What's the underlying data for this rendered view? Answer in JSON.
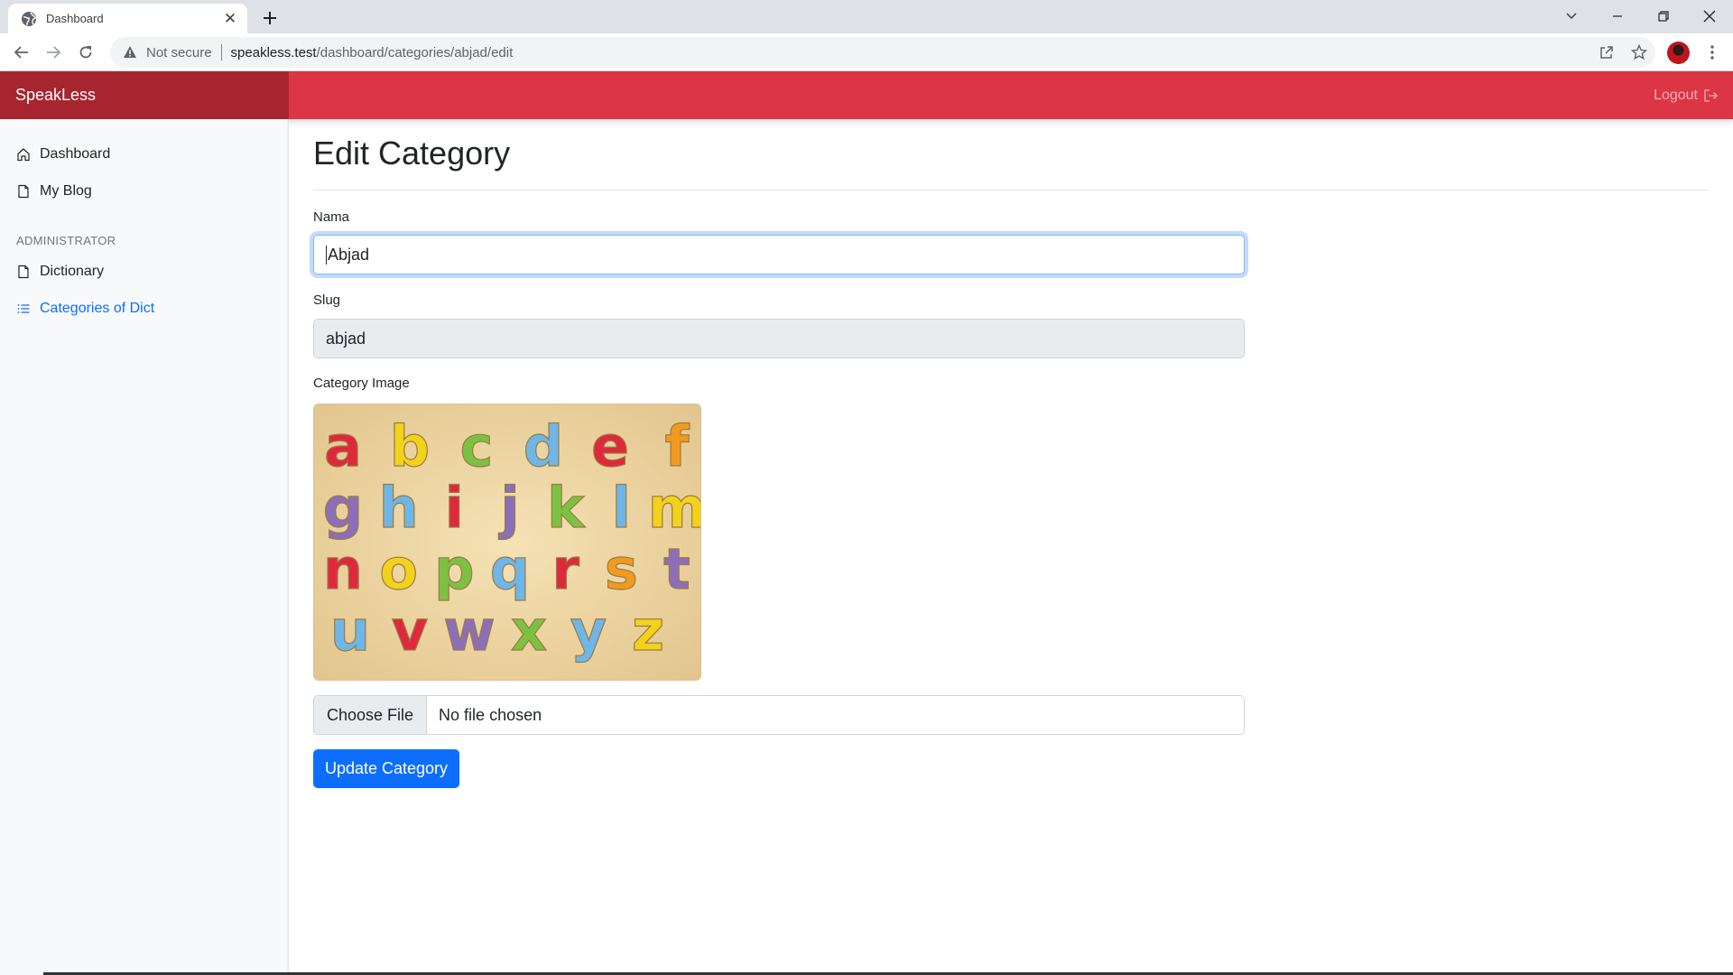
{
  "browser": {
    "tab_title": "Dashboard",
    "security_label": "Not secure",
    "url_host": "speakless.test",
    "url_path": "/dashboard/categories/abjad/edit"
  },
  "header": {
    "brand": "SpeakLess",
    "logout_label": "Logout",
    "accent_color": "#dc3545",
    "brand_bg_color": "#a7252f"
  },
  "sidebar": {
    "items": [
      {
        "label": "Dashboard",
        "icon": "house-icon"
      },
      {
        "label": "My Blog",
        "icon": "file-icon"
      }
    ],
    "admin_heading": "ADMINISTRATOR",
    "admin_items": [
      {
        "label": "Dictionary",
        "icon": "file-icon"
      },
      {
        "label": "Categories of Dict",
        "icon": "list-icon",
        "active": true
      }
    ]
  },
  "main": {
    "title": "Edit Category",
    "form": {
      "name_label": "Nama",
      "name_value": "Abjad",
      "slug_label": "Slug",
      "slug_value": "abjad",
      "image_label": "Category Image",
      "image_letters": [
        "a",
        "b",
        "c",
        "d",
        "e",
        "f",
        "g",
        "h",
        "i",
        "j",
        "k",
        "l",
        "m",
        "n",
        "o",
        "p",
        "q",
        "r",
        "s",
        "t",
        "u",
        "v",
        "w",
        "x",
        "y",
        "z"
      ],
      "file_button": "Choose File",
      "file_status": "No file chosen",
      "submit_label": "Update Category",
      "submit_color": "#0d6efd"
    }
  }
}
